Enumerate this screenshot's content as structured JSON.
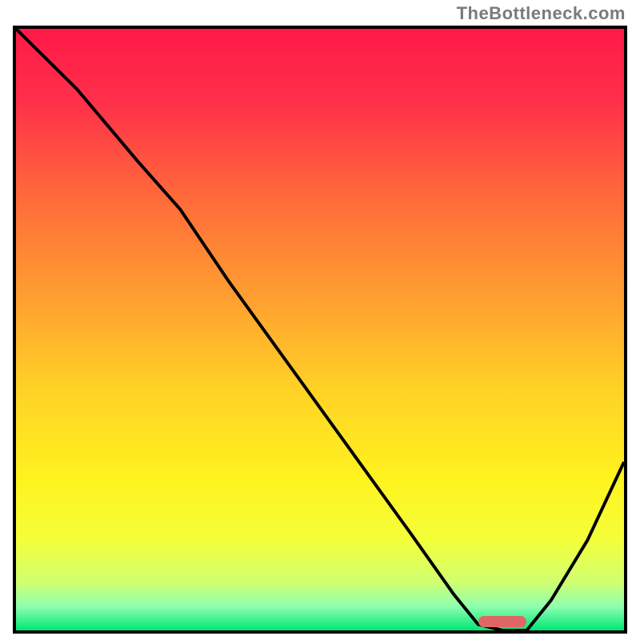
{
  "watermark": "TheBottleneck.com",
  "chart_data": {
    "type": "line",
    "title": "",
    "xlabel": "",
    "ylabel": "",
    "xlim": [
      0,
      100
    ],
    "ylim": [
      0,
      100
    ],
    "series": [
      {
        "name": "curve",
        "x": [
          0,
          10,
          20,
          27,
          35,
          45,
          55,
          65,
          72,
          76,
          80,
          84,
          88,
          94,
          100
        ],
        "y": [
          100,
          90,
          78,
          70,
          58,
          44,
          30,
          16,
          6,
          1,
          0,
          0,
          5,
          15,
          28
        ]
      }
    ],
    "optimal_marker": {
      "x_start": 76,
      "x_end": 84,
      "y": 0.5
    },
    "gradient_stops": [
      {
        "offset": 0.0,
        "color": "#ff1a48"
      },
      {
        "offset": 0.12,
        "color": "#ff2f4a"
      },
      {
        "offset": 0.28,
        "color": "#ff6a3a"
      },
      {
        "offset": 0.45,
        "color": "#ffa030"
      },
      {
        "offset": 0.6,
        "color": "#ffd226"
      },
      {
        "offset": 0.75,
        "color": "#fff31e"
      },
      {
        "offset": 0.85,
        "color": "#f4ff3a"
      },
      {
        "offset": 0.92,
        "color": "#d0ff70"
      },
      {
        "offset": 0.96,
        "color": "#8fffb0"
      },
      {
        "offset": 1.0,
        "color": "#00e676"
      }
    ],
    "marker_color": "#e06666",
    "curve_color": "#000000",
    "curve_width": 4
  }
}
